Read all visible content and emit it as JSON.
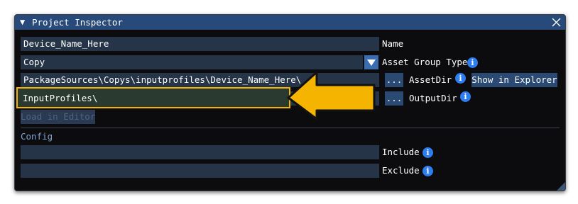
{
  "window": {
    "title": "Project Inspector"
  },
  "fields": {
    "name": {
      "value": "Device_Name_Here",
      "label": "Name"
    },
    "asset_group_type": {
      "value": "Copy",
      "label": "Asset Group Type"
    },
    "asset_dir": {
      "value": "PackageSources\\Copys\\inputprofiles\\Device_Name_Here\\",
      "button": "...",
      "label": "AssetDir",
      "extra_button": "Show in Explorer"
    },
    "output_dir": {
      "value": "InputProfiles\\",
      "button": "...",
      "label": "OutputDir"
    }
  },
  "load_button": "Load in Editor",
  "config": {
    "heading": "Config",
    "include": {
      "value": "",
      "label": "Include"
    },
    "exclude": {
      "value": "",
      "label": "Exclude"
    }
  },
  "icons": {
    "collapse": "triangle-down-icon",
    "close": "close-icon",
    "info": "info-icon",
    "dropdown": "chevron-down-icon",
    "callout": "arrow-icon"
  },
  "colors": {
    "titlebar": "#284a7b",
    "window_bg": "#0c0c0f",
    "field_bg": "#253446",
    "info_icon": "#2e7ef0",
    "highlight": "#f4b400"
  }
}
